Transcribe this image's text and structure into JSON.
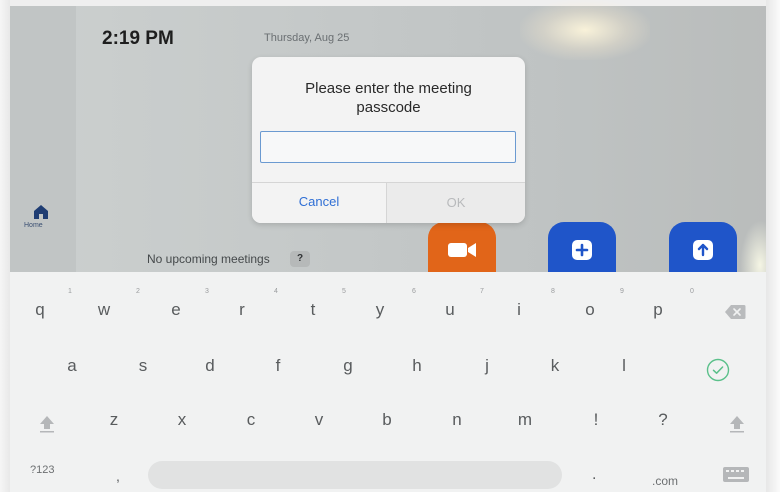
{
  "status": {
    "time": "2:19 PM",
    "date": "Thursday, Aug 25"
  },
  "sidebar": {
    "home_label": "Home"
  },
  "home": {
    "no_meetings": "No upcoming meetings",
    "help": "?"
  },
  "dialog": {
    "title": "Please enter the meeting passcode",
    "input_value": "",
    "cancel_label": "Cancel",
    "ok_label": "OK"
  },
  "keyboard": {
    "row1": [
      "q",
      "w",
      "e",
      "r",
      "t",
      "y",
      "u",
      "i",
      "o",
      "p"
    ],
    "row1_hints": [
      "1",
      "2",
      "3",
      "4",
      "5",
      "6",
      "7",
      "8",
      "9",
      "0"
    ],
    "row2": [
      "a",
      "s",
      "d",
      "f",
      "g",
      "h",
      "j",
      "k",
      "l"
    ],
    "row3": [
      "z",
      "x",
      "c",
      "v",
      "b",
      "n",
      "m",
      "!",
      "?"
    ],
    "symbols_label": "?123",
    "comma": ",",
    "period": ".",
    "com_label": ".com",
    "icons": {
      "backspace": "backspace-icon",
      "enter": "check-circle-icon",
      "shift": "shift-icon",
      "hide_keyboard": "keyboard-icon"
    }
  },
  "colors": {
    "video_tile": "#e16519",
    "action_tile": "#1f55c9",
    "accent": "#2f6fd5",
    "enter_key": "#5ac08a"
  }
}
